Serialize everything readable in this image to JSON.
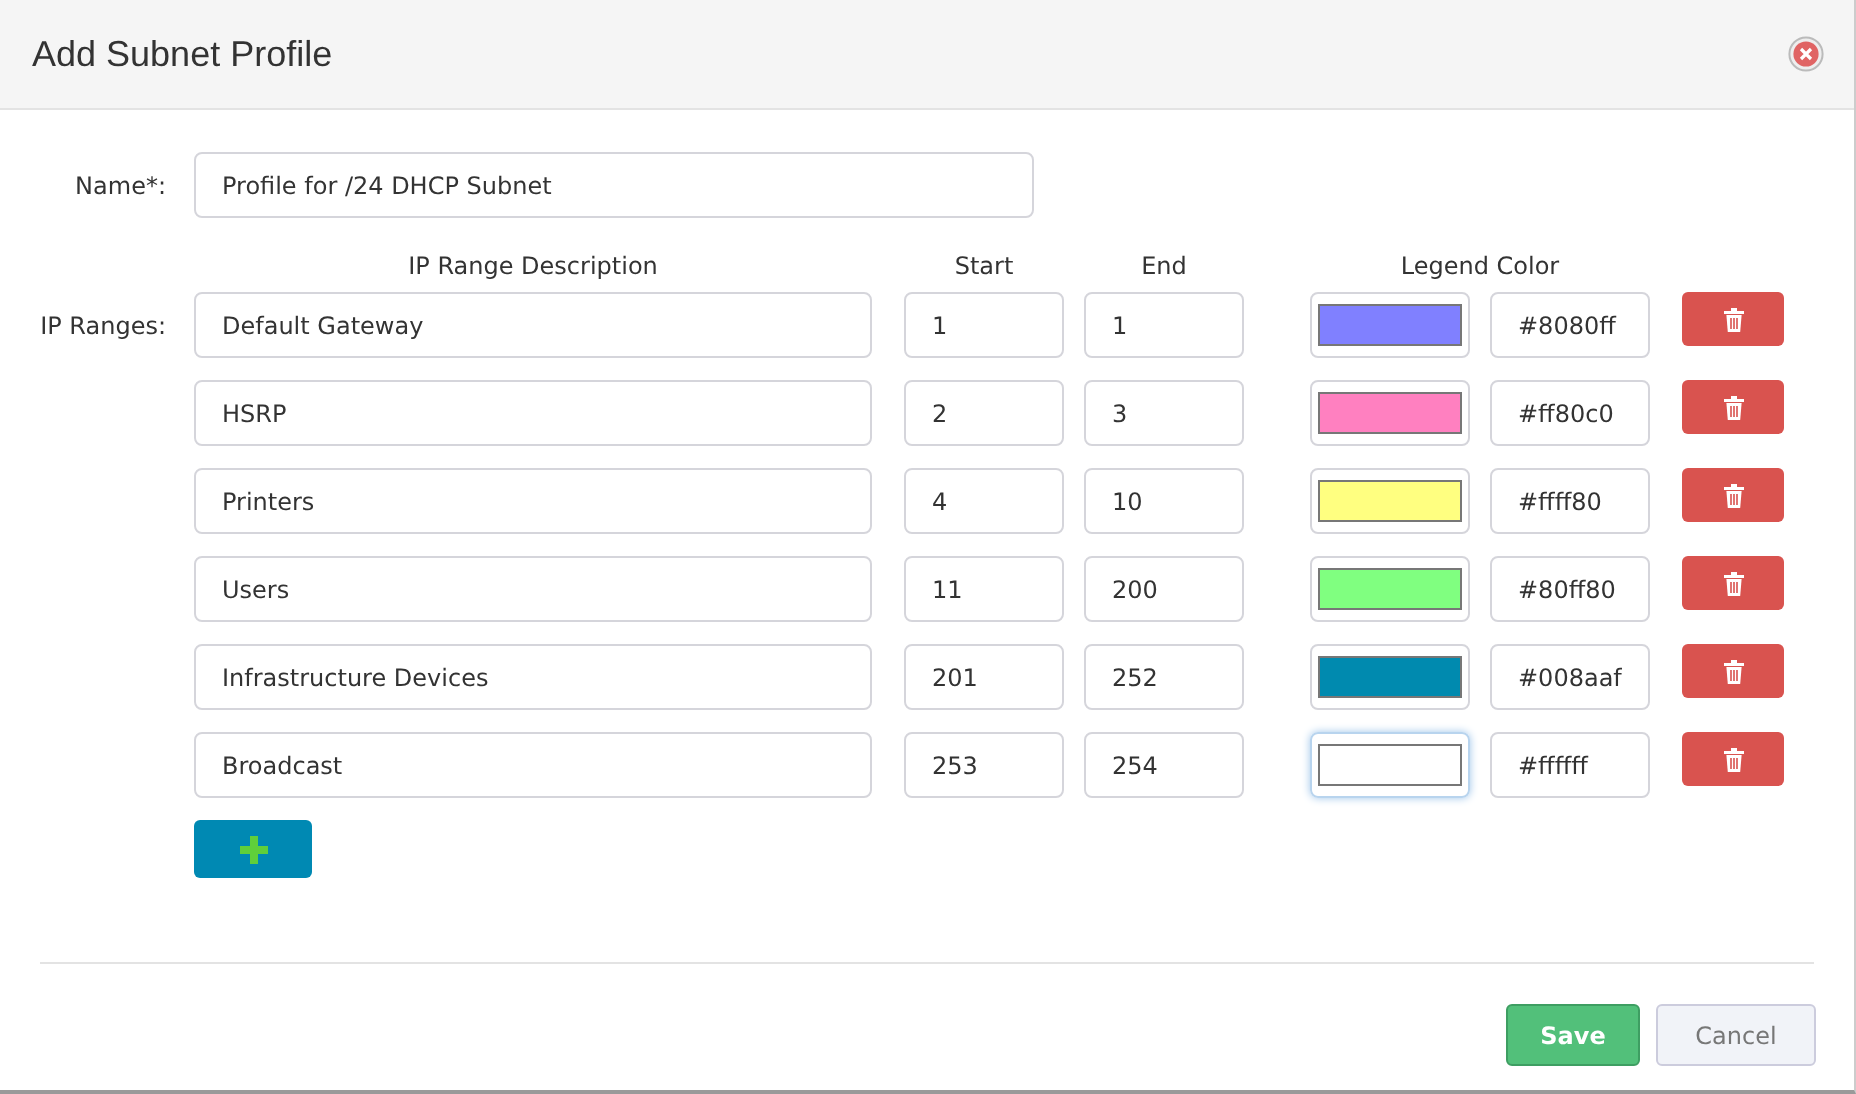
{
  "dialog": {
    "title": "Add Subnet Profile"
  },
  "name_field": {
    "label": "Name*:",
    "value": "Profile for /24 DHCP Subnet"
  },
  "ranges_label": "IP Ranges:",
  "columns": [
    "IP Range Description",
    "Start",
    "End",
    "Legend Color"
  ],
  "ranges": [
    {
      "description": "Default Gateway",
      "start": "1",
      "end": "1",
      "color": "#8080ff",
      "hex": "#8080ff",
      "focused": false
    },
    {
      "description": "HSRP",
      "start": "2",
      "end": "3",
      "color": "#ff80c0",
      "hex": "#ff80c0",
      "focused": false
    },
    {
      "description": "Printers",
      "start": "4",
      "end": "10",
      "color": "#ffff80",
      "hex": "#ffff80",
      "focused": false
    },
    {
      "description": "Users",
      "start": "11",
      "end": "200",
      "color": "#80ff80",
      "hex": "#80ff80",
      "focused": false
    },
    {
      "description": "Infrastructure Devices",
      "start": "201",
      "end": "252",
      "color": "#008aaf",
      "hex": "#008aaf",
      "focused": false
    },
    {
      "description": "Broadcast",
      "start": "253",
      "end": "254",
      "color": "#ffffff",
      "hex": "#ffffff",
      "focused": true
    }
  ],
  "buttons": {
    "save": "Save",
    "cancel": "Cancel"
  }
}
